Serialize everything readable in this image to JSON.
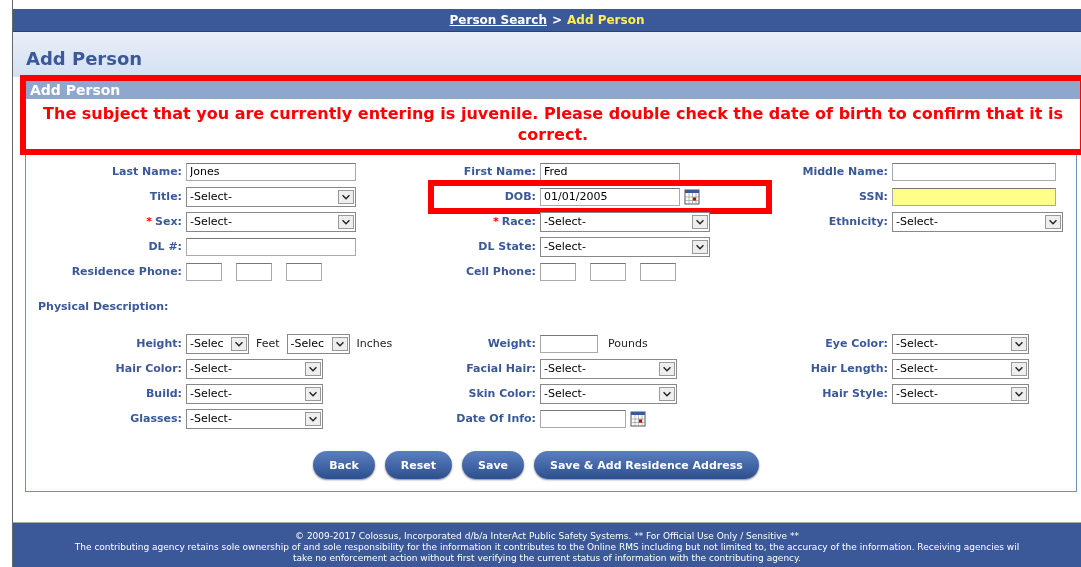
{
  "breadcrumb": {
    "separator": ">",
    "items": [
      {
        "label": "Person Search",
        "kind": "link"
      },
      {
        "label": "Add Person",
        "kind": "current"
      }
    ]
  },
  "page_title": "Add Person",
  "panel": {
    "title": "Add Person",
    "alert": "The subject that you are currently entering is juvenile. Please double check the date of birth to confirm that it is correct."
  },
  "person_rows": [
    [
      {
        "label": "Last Name:",
        "kind": "text",
        "value": "Jones"
      },
      {
        "label": "First Name:",
        "kind": "text",
        "value": "Fred"
      },
      {
        "label": "Middle Name:",
        "kind": "text"
      }
    ],
    [
      {
        "label": "Title:",
        "kind": "select",
        "value": "-Select-"
      },
      {
        "label": "DOB:",
        "kind": "date",
        "value": "01/01/2005",
        "highlighted": true
      },
      {
        "label": "SSN:",
        "kind": "text",
        "focused": true
      }
    ],
    [
      {
        "label": "Sex:",
        "kind": "select",
        "value": "-Select-",
        "required_mark": "*"
      },
      {
        "label": "Race:",
        "kind": "select",
        "value": "-Select-",
        "required_mark": "*"
      },
      {
        "label": "Ethnicity:",
        "kind": "select",
        "value": "-Select-"
      }
    ],
    [
      {
        "label": "DL #:",
        "kind": "text"
      },
      {
        "label": "DL State:",
        "kind": "select",
        "value": "-Select-"
      },
      null
    ],
    [
      {
        "label": "Residence Phone:",
        "kind": "phone"
      },
      {
        "label": "Cell Phone:",
        "kind": "phone"
      },
      null
    ]
  ],
  "physical_title": "Physical Description:",
  "physical_rows": [
    [
      {
        "label": "Height:",
        "kind": "height",
        "selects": [
          {
            "value": "-Selec",
            "unit": "Feet"
          },
          {
            "value": "-Selec",
            "unit": "Inches"
          }
        ]
      },
      {
        "label": "Weight:",
        "kind": "text_unit",
        "unit": "Pounds"
      },
      {
        "label": "Eye Color:",
        "kind": "select",
        "value": "-Select-"
      }
    ],
    [
      {
        "label": "Hair Color:",
        "kind": "select",
        "value": "-Select-"
      },
      {
        "label": "Facial Hair:",
        "kind": "select",
        "value": "-Select-"
      },
      {
        "label": "Hair Length:",
        "kind": "select",
        "value": "-Select-"
      }
    ],
    [
      {
        "label": "Build:",
        "kind": "select",
        "value": "-Select-"
      },
      {
        "label": "Skin Color:",
        "kind": "select",
        "value": "-Select-"
      },
      {
        "label": "Hair Style:",
        "kind": "select",
        "value": "-Select-"
      }
    ],
    [
      {
        "label": "Glasses:",
        "kind": "select",
        "value": "-Select-"
      },
      {
        "label": "Date Of Info:",
        "kind": "date"
      },
      null
    ]
  ],
  "buttons": [
    "Back",
    "Reset",
    "Save",
    "Save & Add Residence Address"
  ],
  "footer": [
    "© 2009-2017 Colossus, Incorporated d/b/a InterAct Public Safety Systems. ** For Official Use Only / Sensitive **",
    "The contributing agency retains sole ownership of and sole responsibility for the information it contributes to the Online RMS including but not limited to, the accuracy of the information. Receiving agencies wil",
    "take no enforcement action without first verifying the current status of information with the contributing agency."
  ]
}
